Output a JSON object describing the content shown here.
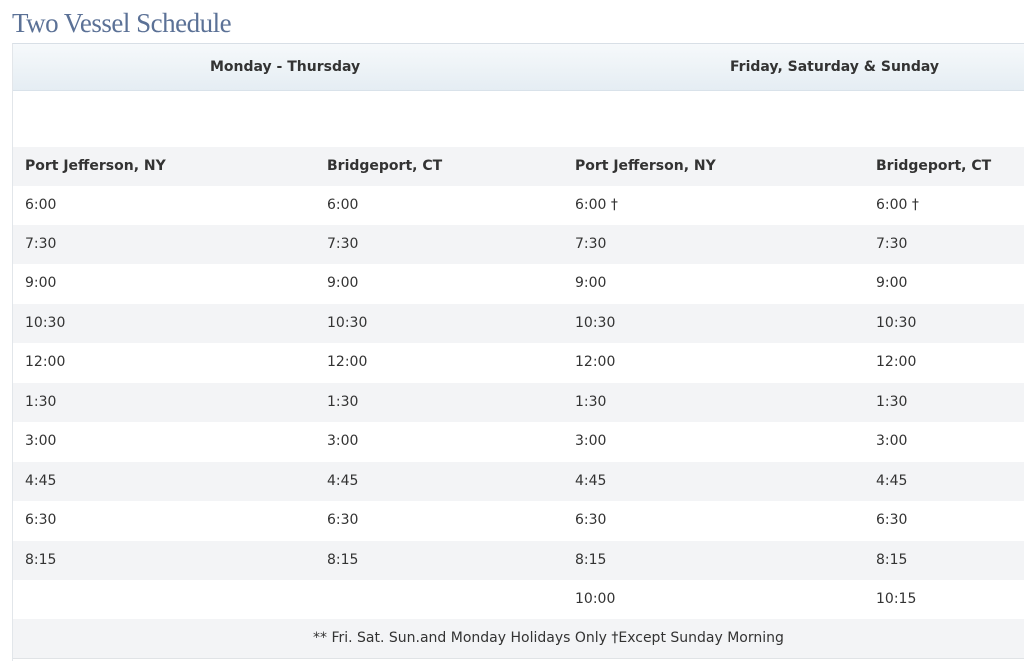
{
  "title": "Two Vessel Schedule",
  "days": {
    "left": "Monday - Thursday",
    "right": "Friday, Saturday & Sunday"
  },
  "columns": [
    "Port Jefferson, NY",
    "Bridgeport, CT",
    "Port Jefferson, NY",
    "Bridgeport, CT"
  ],
  "rows": [
    [
      "6:00",
      "6:00",
      "6:00 †",
      "6:00 †"
    ],
    [
      "7:30",
      "7:30",
      "7:30",
      "7:30"
    ],
    [
      "9:00",
      "9:00",
      "9:00",
      "9:00"
    ],
    [
      "10:30",
      "10:30",
      "10:30",
      "10:30"
    ],
    [
      "12:00",
      "12:00",
      "12:00",
      "12:00"
    ],
    [
      "1:30",
      "1:30",
      "1:30",
      "1:30"
    ],
    [
      "3:00",
      "3:00",
      "3:00",
      "3:00"
    ],
    [
      "4:45",
      "4:45",
      "4:45",
      "4:45"
    ],
    [
      "6:30",
      "6:30",
      "6:30",
      "6:30"
    ],
    [
      "8:15",
      "8:15",
      "8:15",
      "8:15"
    ],
    [
      "",
      "",
      "10:00",
      "10:15"
    ]
  ],
  "footnote": "** Fri. Sat. Sun.and Monday Holidays Only †Except Sunday Morning",
  "colors": {
    "title": "#5b7196",
    "header_band": "#e5edf3",
    "row_shade": "#f3f4f6",
    "text": "#333333"
  }
}
